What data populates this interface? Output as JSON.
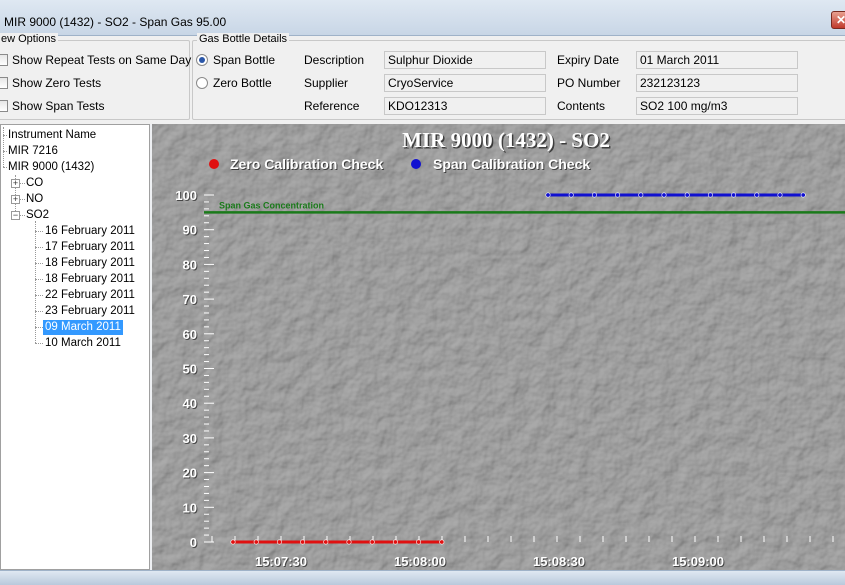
{
  "window": {
    "title": "MIR 9000 (1432) - SO2 - Span Gas 95.00",
    "close_glyph": "✕"
  },
  "view_options": {
    "legend": "ew Options",
    "items": [
      {
        "label": "Show Repeat Tests on Same Day",
        "checked": false
      },
      {
        "label": "Show Zero Tests",
        "checked": false
      },
      {
        "label": "Show Span Tests",
        "checked": false
      }
    ]
  },
  "gas_bottle": {
    "legend": "Gas Bottle Details",
    "bottle_options": [
      {
        "label": "Span Bottle",
        "selected": true
      },
      {
        "label": "Zero Bottle",
        "selected": false
      }
    ],
    "fields": {
      "description": {
        "label": "Description",
        "value": "Sulphur Dioxide"
      },
      "supplier": {
        "label": "Supplier",
        "value": "CryoService"
      },
      "reference": {
        "label": "Reference",
        "value": "KDO12313"
      },
      "expiry_date": {
        "label": "Expiry Date",
        "value": "01 March 2011"
      },
      "po_number": {
        "label": "PO Number",
        "value": "232123123"
      },
      "contents": {
        "label": "Contents",
        "value": "SO2 100 mg/m3"
      }
    }
  },
  "tree": {
    "root": "Instrument Name",
    "instruments": [
      "MIR 7216",
      "MIR 9000 (1432)"
    ],
    "gases": [
      "CO",
      "NO",
      "SO2"
    ],
    "expander_plus": "+",
    "expander_minus": "−",
    "dates": [
      "16 February 2011",
      "17 February 2011",
      "18 February 2011",
      "18 February 2011",
      "22 February 2011",
      "23 February 2011",
      "09 March 2011",
      "10 March 2011"
    ],
    "selected_date_index": 6
  },
  "chart_data": {
    "type": "line",
    "title": "MIR 9000 (1432) - SO2",
    "ylim": [
      0,
      100
    ],
    "y_ticks": [
      0,
      10,
      20,
      30,
      40,
      50,
      60,
      70,
      80,
      90,
      100
    ],
    "x_tick_labels": [
      "15:07:30",
      "15:08:00",
      "15:08:30",
      "15:09:00"
    ],
    "reference_line": {
      "label": "Span Gas Concentration",
      "value": 95,
      "color": "#1a7a1a"
    },
    "legend_position": "top",
    "series": [
      {
        "name": "Zero Calibration Check",
        "color": "#e01010",
        "values": [
          0,
          0,
          0,
          0,
          0,
          0,
          0,
          0,
          0,
          0
        ]
      },
      {
        "name": "Span Calibration Check",
        "color": "#1010d0",
        "values": [
          100,
          100,
          100,
          100,
          100,
          100,
          100,
          100,
          100,
          100,
          100,
          100
        ]
      }
    ]
  }
}
